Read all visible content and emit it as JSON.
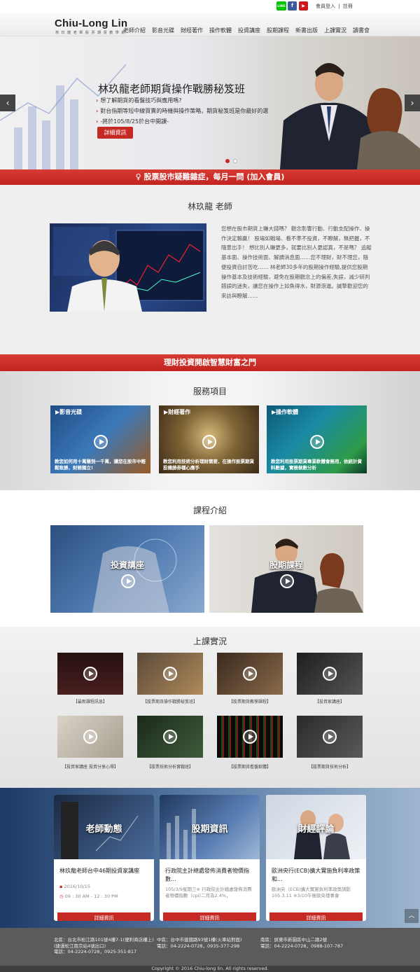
{
  "topbar": {
    "social": [
      {
        "name": "LINE",
        "color": "#00c300"
      },
      {
        "name": "f",
        "color": "#3b5998"
      },
      {
        "name": "▶",
        "color": "#cc181e"
      }
    ],
    "login": "會員登入",
    "register": "註冊",
    "divider": "|"
  },
  "header": {
    "logo_title": "Chiu-Long Lin",
    "logo_sub": "林 玖 龍 老 師 股 票 期 貨 教 學 網",
    "nav": [
      "老師介紹",
      "影音光碟",
      "財經著作",
      "操作軟體",
      "投資講座",
      "股期課程",
      "新書出版",
      "上課實況",
      "讀書會"
    ]
  },
  "hero": {
    "title": "林玖龍老師期貨操作戰勝秘笈班",
    "lines": [
      "想了解期貨的看盤技巧與應用嗎?",
      "對台指期等短中線買賣的時機與操作策略，期貨秘笈班是你最好的選",
      "-將於105/8/25於台中開課-"
    ],
    "marker": "›",
    "button": "詳細資訊",
    "prev": "‹",
    "next": "›"
  },
  "qa_bar": {
    "icon": "lightbulb-icon",
    "text": "股票股市疑難雜症，每月一問 (加入會員)"
  },
  "teacher": {
    "title": "林玖龍 老師",
    "bio": "您想在股市期貨上賺大錢嗎？ 觀念影響行動、行動支配操作、操作決定輸贏！ 股場如戰場、看不準不投資，不瞭解，無把握，不隨意出手！ 想比別人賺更多，就要比別人更認真，不是嗎？ 追蹤基本面、操作技術面、解讀消息面……您不理財，財不理您，隨便投資自討苦吃…… 林老師30多年的股期操作經驗,提供您股期操作基本及技術經驗，避免在股期觀念上的偏差,失誤，減少研判錯誤的迷失，讓您在操作上如魚得水，財源滾進。誠摯歡迎您的來訪與瞭解……"
  },
  "slogan_bar": "理財投資開啟智慧財富之門",
  "services": {
    "title": "服務項目",
    "items": [
      {
        "label": "影音光碟",
        "caption": "教您如何用十萬賺到一千萬，讓您在股市中輕鬆致勝，財務獨立!"
      },
      {
        "label": "財經著作",
        "caption": "教您利用技術分析理財需要，在操作股票期貨投機勝券穩心應手"
      },
      {
        "label": "操作軟體",
        "caption": "教您利用股票期貨專業軟體會務用，依統計資料數據，實務做數分析"
      }
    ]
  },
  "courses": {
    "title": "課程介紹",
    "items": [
      {
        "label": "投資講座"
      },
      {
        "label": "股期課程"
      }
    ]
  },
  "classes": {
    "title": "上課實況",
    "items": [
      "【最新課程訊息】",
      "【股票期貨操作戰勝秘笈班】",
      "【股票期貨教學課程】",
      "【投資家講座】",
      "【投資家講座 投資分享心得】",
      "【股票技術分析實戰班】",
      "【股票期貨看盤軟體】",
      "【股票期貨技術分析】"
    ]
  },
  "news": {
    "cards": [
      {
        "label": "老師動態",
        "title": "林玖龍老師台中46期投資家講座",
        "meta1": "2016/10/15",
        "meta2": "09 : 30 AM - 12 : 30 PM",
        "button": "詳細資訊"
      },
      {
        "label": "股期資訊",
        "title": "行政院主計總處發佈消費者物價指數...",
        "meta1": "105/3/9星期三※ 行政院主計總處發佈消費者物價指數（cpi)二月為2.4%，",
        "meta2": "",
        "button": "詳細資訊"
      },
      {
        "label": "財經評論",
        "title": "歐洲央行(ECB)擴大實施負利率政策和...",
        "meta1": "歐洲央（ECB)擴大實施負利率政策調影105.3.11 ※3/10午後歐央理事會",
        "meta2": "",
        "button": "詳細資訊"
      }
    ],
    "to_top": "︿"
  },
  "footer": {
    "col1": [
      "北區：台北市松江路101號4樓7-1(便利商店樓上)",
      "(捷運松江南京站4號出口)",
      "電話：04-2224-0728，0925-351-817"
    ],
    "col2": [
      "中區：台中市建國路93號1樓(火車站對面)",
      "電話：04-2224-0728，0935-377-298"
    ],
    "col3": [
      "南區：屏東市新園區中山二路2號",
      "電話：04-2224-0728，0988-107-787"
    ],
    "copyright": "Copyright © 2016 Chiu-long lin. All rights reserved."
  }
}
